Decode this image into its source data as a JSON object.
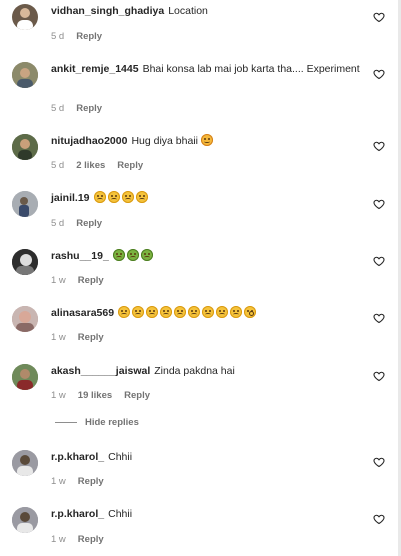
{
  "comments": [
    {
      "username": "vidhan_singh_ghadiya",
      "text": "Location",
      "time": "5 d",
      "likes": "",
      "reply": "Reply",
      "avatar_color": "#6b5a4a"
    },
    {
      "username": "ankit_remje_1445",
      "text": "Bhai konsa lab mai job karta tha.... Experiment",
      "time": "5 d",
      "likes": "",
      "reply": "Reply",
      "avatar_color": "#7a7a5a"
    },
    {
      "username": "nitujadhao2000",
      "text": "Hug diya bhaii",
      "time": "5 d",
      "likes": "2 likes",
      "reply": "Reply",
      "avatar_color": "#4a5a3a"
    },
    {
      "username": "jainil.19",
      "text": "",
      "time": "5 d",
      "likes": "",
      "reply": "Reply",
      "avatar_color": "#9aa0a8"
    },
    {
      "username": "rashu__19_",
      "text": "",
      "time": "1 w",
      "likes": "",
      "reply": "Reply",
      "avatar_color": "#3a3a3a"
    },
    {
      "username": "alinasara569",
      "text": "",
      "time": "1 w",
      "likes": "",
      "reply": "Reply",
      "avatar_color": "#b08a88"
    },
    {
      "username": "akash______jaiswal",
      "text": "Zinda pakdna hai",
      "time": "1 w",
      "likes": "19 likes",
      "reply": "Reply",
      "avatar_color": "#5a7a4a"
    },
    {
      "username": "r.p.kharol_",
      "text": "Chhii",
      "time": "1 w",
      "likes": "",
      "reply": "Reply",
      "avatar_color": "#8a8a90"
    },
    {
      "username": "r.p.kharol_",
      "text": "Chhii",
      "time": "1 w",
      "likes": "",
      "reply": "Reply",
      "avatar_color": "#8a8a90"
    }
  ],
  "hide_replies_label": "Hide replies",
  "icons": {
    "like": "heart-outline-icon"
  }
}
